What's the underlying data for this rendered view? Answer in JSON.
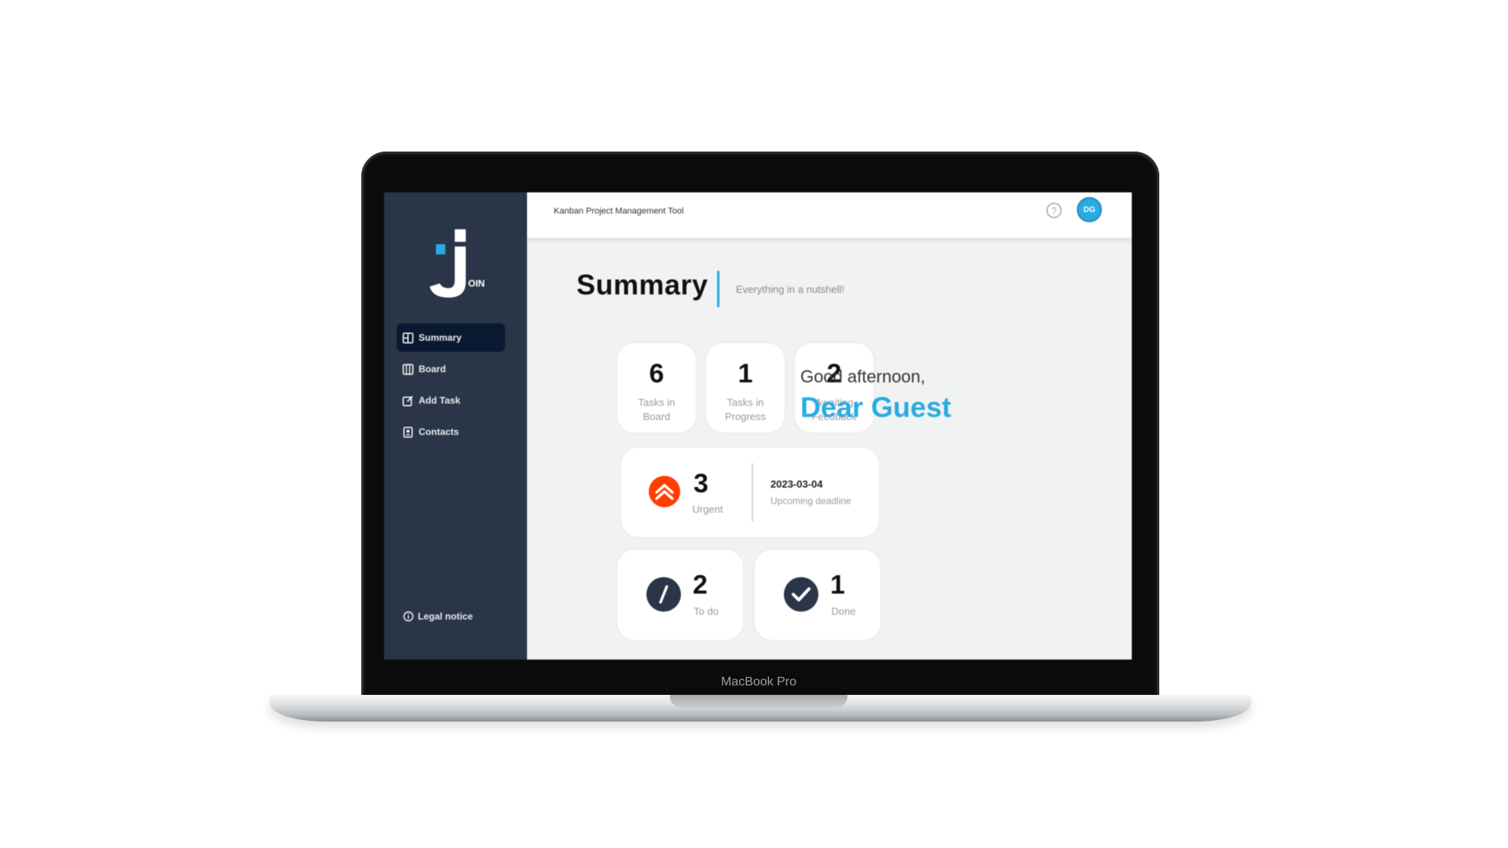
{
  "device": {
    "label": "MacBook Pro"
  },
  "sidebar": {
    "logo_text": "OIN",
    "items": [
      {
        "label": "Summary",
        "icon": "summary-icon",
        "active": true
      },
      {
        "label": "Board",
        "icon": "board-icon",
        "active": false
      },
      {
        "label": "Add Task",
        "icon": "add-task-icon",
        "active": false
      },
      {
        "label": "Contacts",
        "icon": "contacts-icon",
        "active": false
      }
    ],
    "legal": {
      "label": "Legal notice",
      "icon": "info-icon"
    }
  },
  "header": {
    "title": "Kanban Project Management Tool",
    "help_icon": "help-icon",
    "avatar_initials": "DG"
  },
  "summary": {
    "title": "Summary",
    "subtitle": "Everything in a nutshell!",
    "cards": [
      {
        "number": "6",
        "label": "Tasks in Board"
      },
      {
        "number": "1",
        "label": "Tasks in Progress"
      },
      {
        "number": "2",
        "label": "Awaiting Feedback"
      }
    ],
    "urgent": {
      "number": "3",
      "label": "Urgent",
      "icon": "urgent-priority-icon"
    },
    "deadline": {
      "date": "2023-03-04",
      "label": "Upcoming deadline"
    },
    "todo": {
      "number": "2",
      "label": "To do",
      "icon": "pencil-icon"
    },
    "done": {
      "number": "1",
      "label": "Done",
      "icon": "check-icon"
    }
  },
  "greeting": {
    "text": "Good afternoon,",
    "name": "Dear Guest"
  },
  "colors": {
    "sidebar_bg": "#2a3647",
    "sidebar_active": "#091931",
    "accent": "#29abe2",
    "urgent": "#ff3d00",
    "screen_bg": "#f1f2f2"
  }
}
